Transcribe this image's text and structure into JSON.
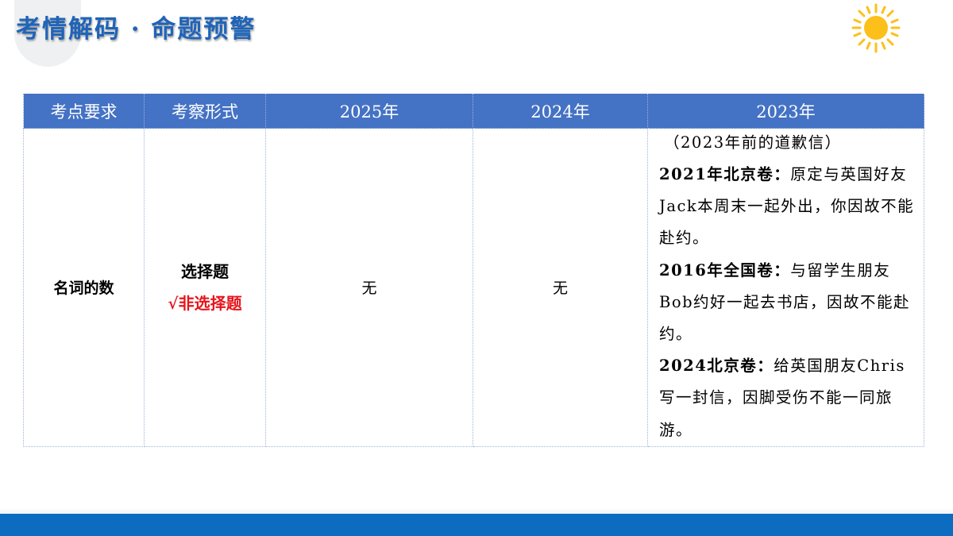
{
  "title": "考情解码 · 命题预警",
  "colors": {
    "title": "#1f64b8",
    "header_bg": "#4472c4",
    "highlight_red": "#e8141b",
    "sun": "#fdbf1a",
    "footer": "#0b6cc0"
  },
  "icons": {
    "sun": "sun-icon"
  },
  "table": {
    "headers": [
      "考点要求",
      "考察形式",
      "2025年",
      "2024年",
      "2023年"
    ],
    "row": {
      "requirement": "名词的数",
      "form_option_1": "选择题",
      "form_option_2": "√非选择题",
      "y2025": "无",
      "y2024": "无",
      "y2023": {
        "intro": "（2023年前的道歉信）",
        "items": [
          {
            "label": "2021年北京卷：",
            "text": "原定与英国好友Jack本周末一起外出，你因故不能赴约。"
          },
          {
            "label": "2016年全国卷：",
            "text": "与留学生朋友Bob约好一起去书店，因故不能赴约。"
          },
          {
            "label": "2024北京卷：",
            "text": "给英国朋友Chris写一封信，因脚受伤不能一同旅游。"
          }
        ]
      }
    }
  }
}
